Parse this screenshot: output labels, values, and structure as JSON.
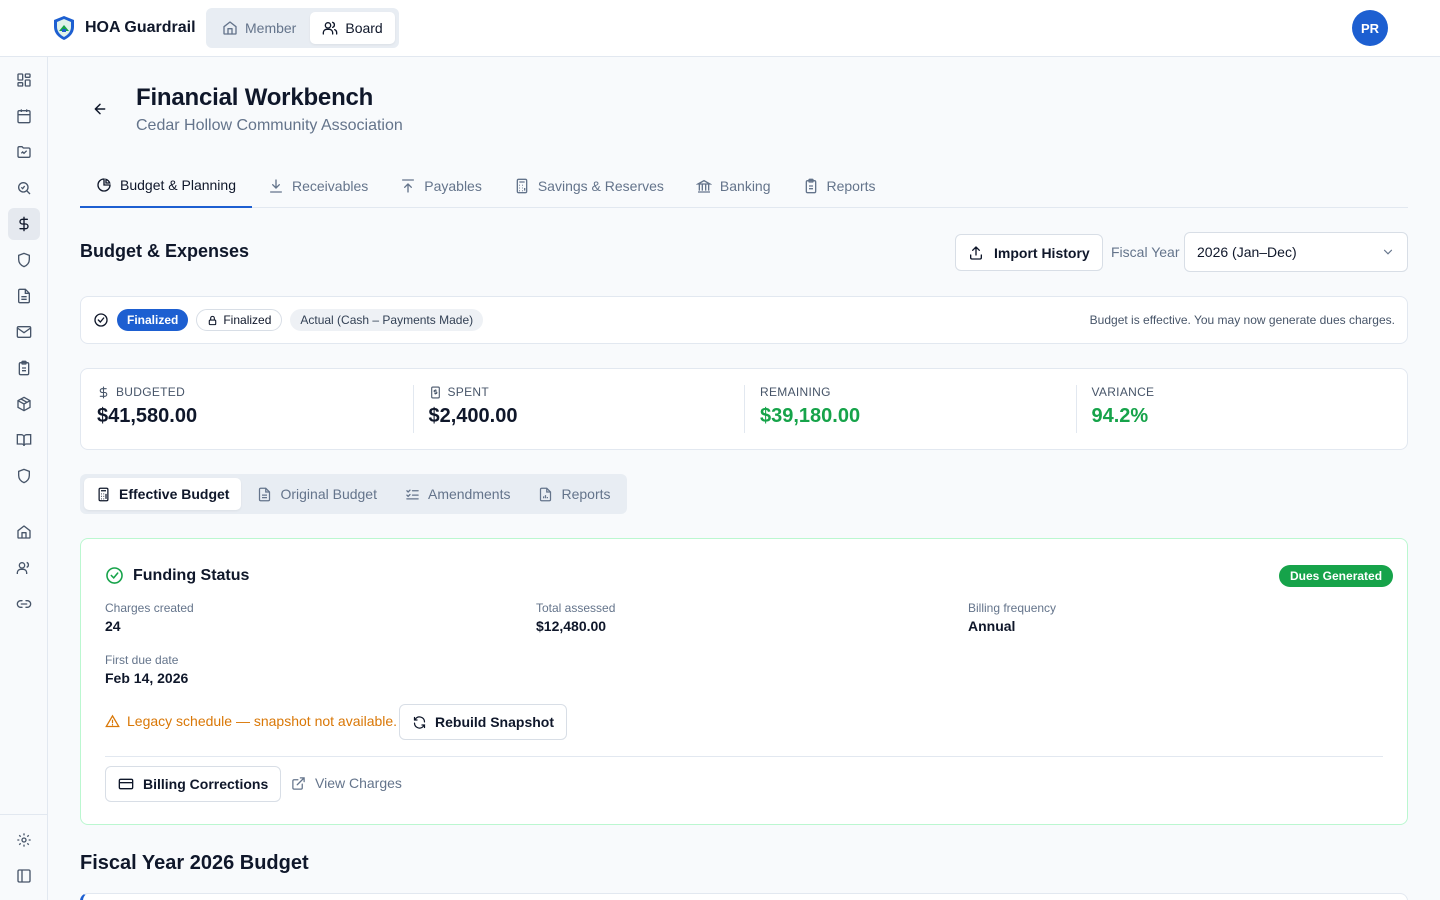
{
  "app": {
    "name": "HOA Guardrail"
  },
  "mode_switch": [
    {
      "label": "Member",
      "icon": "home-icon",
      "active": false
    },
    {
      "label": "Board",
      "icon": "users-icon",
      "active": true
    }
  ],
  "user": {
    "initials": "PR"
  },
  "colors": {
    "primary": "#1d5fd1",
    "success": "#16a34a",
    "warning": "#d97706"
  },
  "sidebar": {
    "items": [
      {
        "icon": "dashboard-icon"
      },
      {
        "icon": "calendar-icon"
      },
      {
        "icon": "folder-icon"
      },
      {
        "icon": "search-icon"
      },
      {
        "icon": "dollar-icon",
        "active": true
      },
      {
        "icon": "shield-icon"
      },
      {
        "icon": "document-icon"
      },
      {
        "icon": "mail-icon"
      },
      {
        "icon": "clipboard-icon"
      },
      {
        "icon": "package-icon"
      },
      {
        "icon": "book-icon"
      },
      {
        "icon": "shield-icon"
      },
      {
        "icon": "home-icon"
      },
      {
        "icon": "users-icon"
      },
      {
        "icon": "link-icon"
      }
    ],
    "footer": [
      {
        "icon": "gear-icon"
      },
      {
        "icon": "panel-toggle-icon"
      }
    ]
  },
  "header": {
    "title": "Financial Workbench",
    "subtitle": "Cedar Hollow Community Association"
  },
  "tabs": [
    {
      "label": "Budget & Planning",
      "icon": "pie-chart-icon",
      "active": true
    },
    {
      "label": "Receivables",
      "icon": "download-icon"
    },
    {
      "label": "Payables",
      "icon": "upload-icon"
    },
    {
      "label": "Savings & Reserves",
      "icon": "calculator-icon"
    },
    {
      "label": "Banking",
      "icon": "bank-icon"
    },
    {
      "label": "Reports",
      "icon": "clipboard-icon"
    }
  ],
  "budget": {
    "section_title": "Budget & Expenses",
    "import_label": "Import History",
    "fiscal_year_label": "Fiscal Year",
    "fiscal_year_value": "2026 (Jan–Dec)",
    "status": {
      "badge_primary": "Finalized",
      "badge_lock": "Finalized",
      "badge_basis": "Actual (Cash – Payments Made)",
      "note": "Budget is effective. You may now generate dues charges."
    },
    "stats": [
      {
        "label": "BUDGETED",
        "value": "$41,580.00",
        "icon": "dollar-icon"
      },
      {
        "label": "SPENT",
        "value": "$2,400.00",
        "icon": "receipt-icon"
      },
      {
        "label": "REMAINING",
        "value": "$39,180.00"
      },
      {
        "label": "VARIANCE",
        "value": "94.2%"
      }
    ]
  },
  "subtabs": [
    {
      "label": "Effective Budget",
      "icon": "calculator-icon",
      "active": true
    },
    {
      "label": "Original Budget",
      "icon": "document-icon"
    },
    {
      "label": "Amendments",
      "icon": "list-check-icon"
    },
    {
      "label": "Reports",
      "icon": "chart-file-icon"
    }
  ],
  "funding": {
    "title": "Funding Status",
    "badge": "Dues Generated",
    "charges_created_label": "Charges created",
    "charges_created_value": "24",
    "total_assessed_label": "Total assessed",
    "total_assessed_value": "$12,480.00",
    "billing_frequency_label": "Billing frequency",
    "billing_frequency_value": "Annual",
    "first_due_label": "First due date",
    "first_due_value": "Feb 14, 2026",
    "legacy_warning": "Legacy schedule — snapshot not available.",
    "rebuild_label": "Rebuild Snapshot",
    "billing_corrections_label": "Billing Corrections",
    "view_charges_label": "View Charges"
  },
  "fiscal_budget": {
    "title": "Fiscal Year 2026 Budget"
  }
}
